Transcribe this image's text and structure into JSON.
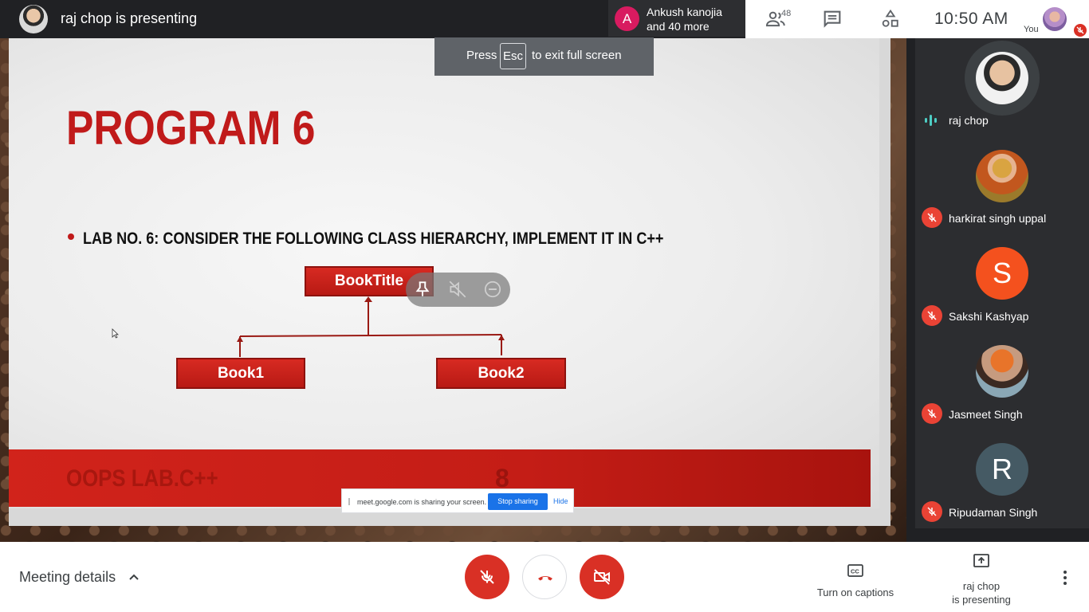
{
  "topbar": {
    "presenting_title": "raj chop is presenting",
    "participants_pill": {
      "avatar_letter": "A",
      "line1": "Ankush kanojia",
      "line2": "and 40 more"
    },
    "people_count": "48",
    "time": "10:50  AM",
    "you_label": "You"
  },
  "toast": {
    "press": "Press",
    "key": "Esc",
    "rest": "to exit full screen"
  },
  "slide": {
    "title": "PROGRAM 6",
    "lab_text": "LAB NO. 6: CONSIDER THE FOLLOWING CLASS HIERARCHY, IMPLEMENT IT IN C++",
    "diagram": {
      "parent": "BookTitle",
      "child_left": "Book1",
      "child_right": "Book2"
    },
    "footer_course": "OOPS LAB.C++",
    "footer_page": "8"
  },
  "share_bar": {
    "message": "meet.google.com is sharing your screen.",
    "stop": "Stop sharing",
    "hide": "Hide"
  },
  "panel": {
    "participants": [
      {
        "name": "raj chop",
        "avatar_letter": "",
        "status": "speaking"
      },
      {
        "name": "harkirat singh uppal",
        "avatar_letter": "",
        "status": "muted"
      },
      {
        "name": "Sakshi Kashyap",
        "avatar_letter": "S",
        "status": "muted",
        "color": "#f4511e"
      },
      {
        "name": "Jasmeet Singh",
        "avatar_letter": "",
        "status": "muted"
      },
      {
        "name": "Ripudaman Singh",
        "avatar_letter": "R",
        "status": "muted",
        "color": "#455a64"
      }
    ]
  },
  "bottombar": {
    "meeting_details": "Meeting details",
    "captions": "Turn on captions",
    "present_line1": "raj chop",
    "present_line2": "is presenting"
  },
  "colors": {
    "danger": "#d93025",
    "accent": "#1a73e8",
    "slide_red": "#c01a1a"
  },
  "icons": [
    "people-icon",
    "chat-icon",
    "activities-icon",
    "mic-off-icon",
    "hangup-icon",
    "camera-off-icon",
    "captions-icon",
    "present-icon",
    "more-vert-icon",
    "pin-icon",
    "mute-icon",
    "remove-icon",
    "chevron-up-icon"
  ]
}
